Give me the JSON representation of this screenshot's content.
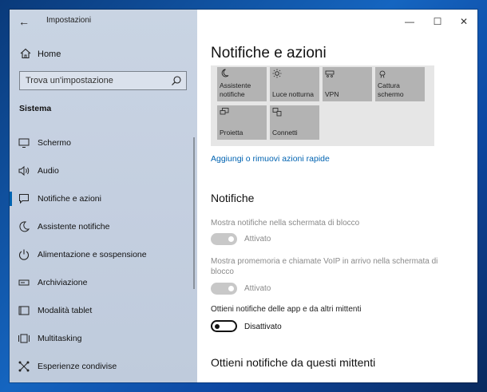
{
  "window": {
    "title": "Impostazioni",
    "back_glyph": "←",
    "controls": {
      "minimize": "—",
      "maximize": "☐",
      "close": "✕"
    }
  },
  "sidebar": {
    "home_label": "Home",
    "search_placeholder": "Trova un'impostazione",
    "section_title": "Sistema",
    "items": [
      {
        "label": "Schermo",
        "icon": "monitor-icon"
      },
      {
        "label": "Audio",
        "icon": "speaker-icon"
      },
      {
        "label": "Notifiche e azioni",
        "icon": "notification-icon",
        "active": true
      },
      {
        "label": "Assistente notifiche",
        "icon": "moon-icon"
      },
      {
        "label": "Alimentazione e sospensione",
        "icon": "power-icon"
      },
      {
        "label": "Archiviazione",
        "icon": "storage-icon"
      },
      {
        "label": "Modalità tablet",
        "icon": "tablet-icon"
      },
      {
        "label": "Multitasking",
        "icon": "multitasking-icon"
      },
      {
        "label": "Esperienze condivise",
        "icon": "share-icon"
      }
    ]
  },
  "main": {
    "title": "Notifiche e azioni",
    "quick_actions": [
      {
        "label": "Assistente notifiche",
        "icon": "moon-icon"
      },
      {
        "label": "Luce notturna",
        "icon": "sun-icon"
      },
      {
        "label": "VPN",
        "icon": "vpn-icon"
      },
      {
        "label": "Cattura schermo",
        "icon": "snip-icon"
      },
      {
        "label": "Proietta",
        "icon": "project-icon"
      },
      {
        "label": "Connetti",
        "icon": "connect-icon"
      }
    ],
    "quick_actions_link": "Aggiungi o rimuovi azioni rapide",
    "notifications_heading": "Notifiche",
    "options": [
      {
        "label": "Mostra notifiche nella schermata di blocco",
        "state": "Attivato",
        "enabled": false,
        "on": true
      },
      {
        "label": "Mostra promemoria e chiamate VoIP in arrivo nella schermata di blocco",
        "state": "Attivato",
        "enabled": false,
        "on": true
      },
      {
        "label": "Ottieni notifiche delle app e da altri mittenti",
        "state": "Disattivato",
        "enabled": true,
        "on": false
      }
    ],
    "senders_heading": "Ottieni notifiche da questi mittenti"
  },
  "colors": {
    "accent": "#0063b1",
    "sidebar_bg": "#c6d1e1",
    "tile_bg": "#b3b3b3",
    "panel_bg": "#e6e6e6"
  }
}
